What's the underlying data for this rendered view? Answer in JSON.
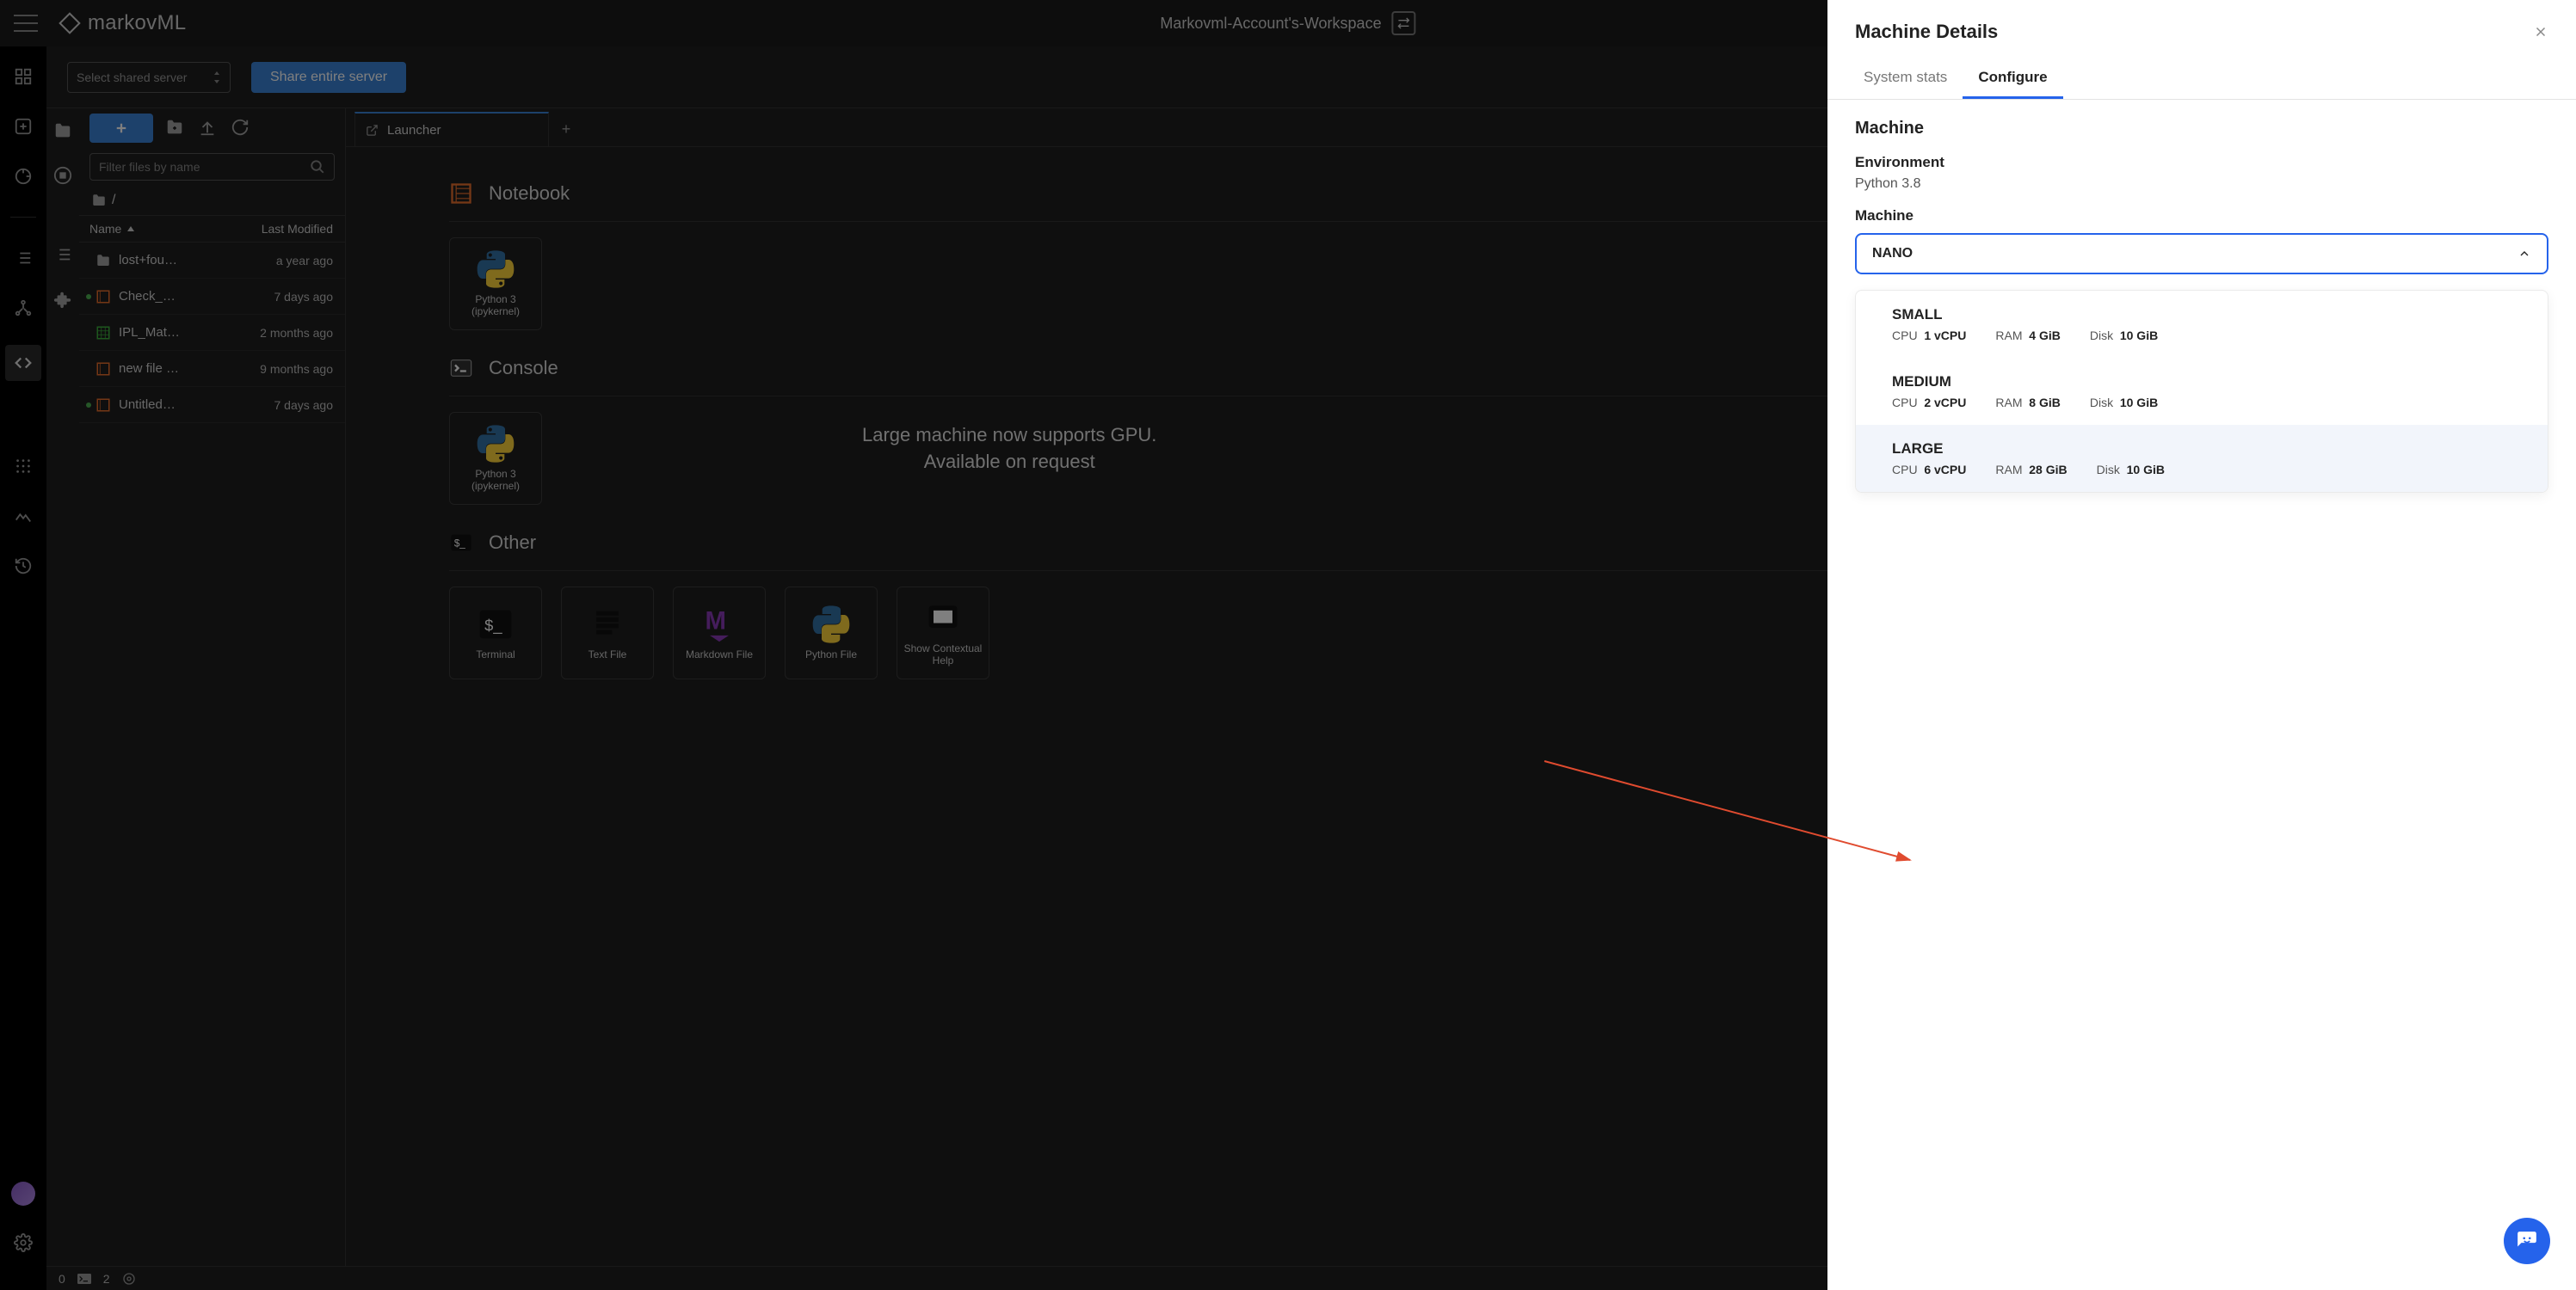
{
  "topbar": {
    "logo_text": "markovML",
    "workspace_name": "Markovml-Account's-Workspace"
  },
  "server_bar": {
    "select_placeholder": "Select shared server",
    "share_button": "Share entire server"
  },
  "file_browser": {
    "filter_placeholder": "Filter files by name",
    "breadcrumb": "/",
    "col_name": "Name",
    "col_modified": "Last Modified",
    "rows": [
      {
        "icon": "folder",
        "running": false,
        "name": "lost+fou…",
        "modified": "a year ago"
      },
      {
        "icon": "notebook",
        "running": true,
        "name": "Check_…",
        "modified": "7 days ago"
      },
      {
        "icon": "sheet",
        "running": false,
        "name": "IPL_Mat…",
        "modified": "2 months ago"
      },
      {
        "icon": "notebook",
        "running": false,
        "name": "new file …",
        "modified": "9 months ago"
      },
      {
        "icon": "notebook",
        "running": true,
        "name": "Untitled…",
        "modified": "7 days ago"
      }
    ]
  },
  "launcher": {
    "tab_label": "Launcher",
    "sections": {
      "notebook": {
        "title": "Notebook",
        "cards": [
          {
            "label": "Python 3 (ipykernel)"
          }
        ]
      },
      "console": {
        "title": "Console",
        "cards": [
          {
            "label": "Python 3 (ipykernel)"
          }
        ]
      },
      "other": {
        "title": "Other",
        "cards": [
          {
            "label": "Terminal"
          },
          {
            "label": "Text File"
          },
          {
            "label": "Markdown File"
          },
          {
            "label": "Python File"
          },
          {
            "label": "Show Contextual Help"
          }
        ]
      }
    },
    "callout_line1": "Large machine now supports GPU.",
    "callout_line2": "Available on request"
  },
  "statusbar": {
    "left_num": "0",
    "terminals": "2"
  },
  "drawer": {
    "title": "Machine Details",
    "tabs": {
      "stats": "System stats",
      "configure": "Configure"
    },
    "section_heading": "Machine",
    "env_label": "Environment",
    "env_value": "Python 3.8",
    "machine_label": "Machine",
    "selected": "NANO",
    "options": [
      {
        "name": "SMALL",
        "cpu": "1 vCPU",
        "ram": "4 GiB",
        "disk": "10 GiB",
        "highlight": false
      },
      {
        "name": "MEDIUM",
        "cpu": "2 vCPU",
        "ram": "8 GiB",
        "disk": "10 GiB",
        "highlight": false
      },
      {
        "name": "LARGE",
        "cpu": "6 vCPU",
        "ram": "28 GiB",
        "disk": "10 GiB",
        "highlight": true
      }
    ],
    "spec_labels": {
      "cpu": "CPU",
      "ram": "RAM",
      "disk": "Disk"
    }
  }
}
